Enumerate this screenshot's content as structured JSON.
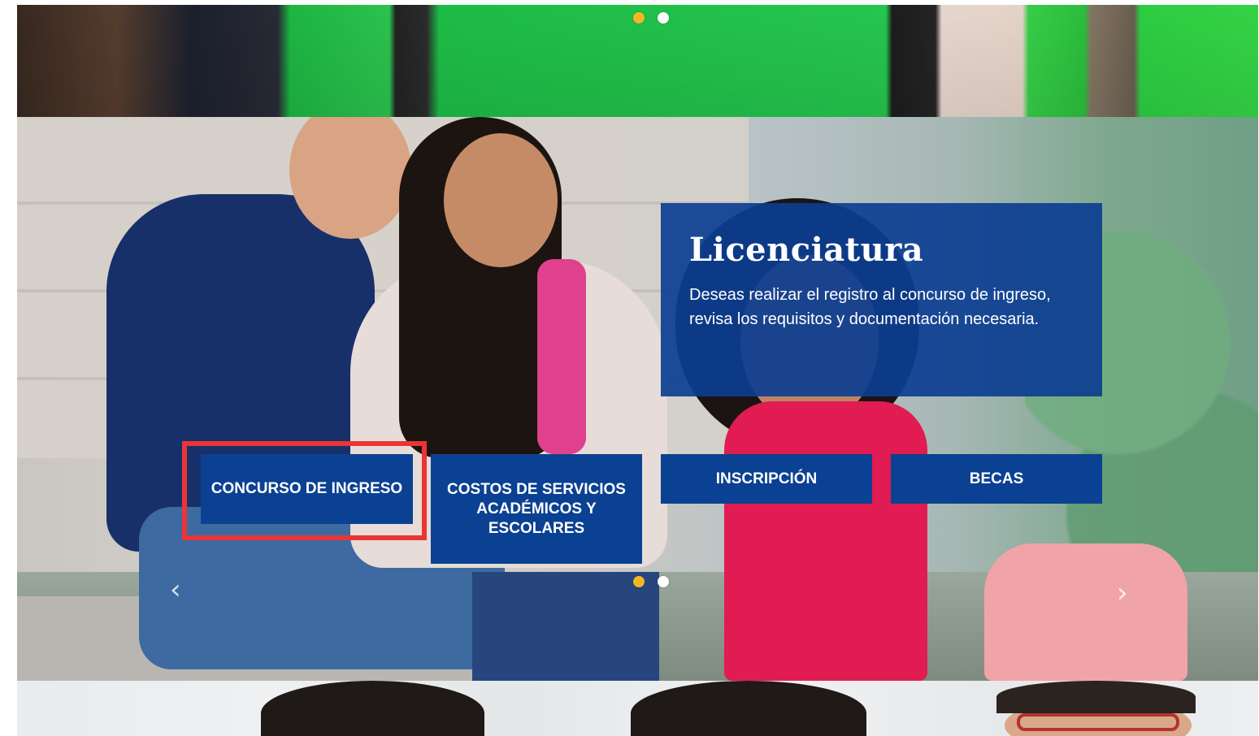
{
  "carousel": {
    "top_dots_count": 2,
    "top_active_index": 0,
    "mid_dots_count": 2,
    "mid_active_index": 0
  },
  "hero": {
    "title": "Licenciatura",
    "description": "Deseas realizar el registro al concurso de ingreso, revisa los requisitos y documentación necesaria."
  },
  "buttons": {
    "concurso": "CONCURSO DE INGRESO",
    "costos": "COSTOS DE SERVICIOS ACADÉMICOS Y ESCOLARES",
    "inscripcion": "INSCRIPCIÓN",
    "becas": "BECAS"
  },
  "colors": {
    "panel_blue": "#0c3e91",
    "button_blue": "#0b4192",
    "highlight_red": "#ea3535",
    "dot_active": "#f2b824",
    "dot_inactive": "#ffffff"
  },
  "icons": {
    "prev": "chevron-left-icon",
    "next": "chevron-right-icon"
  }
}
